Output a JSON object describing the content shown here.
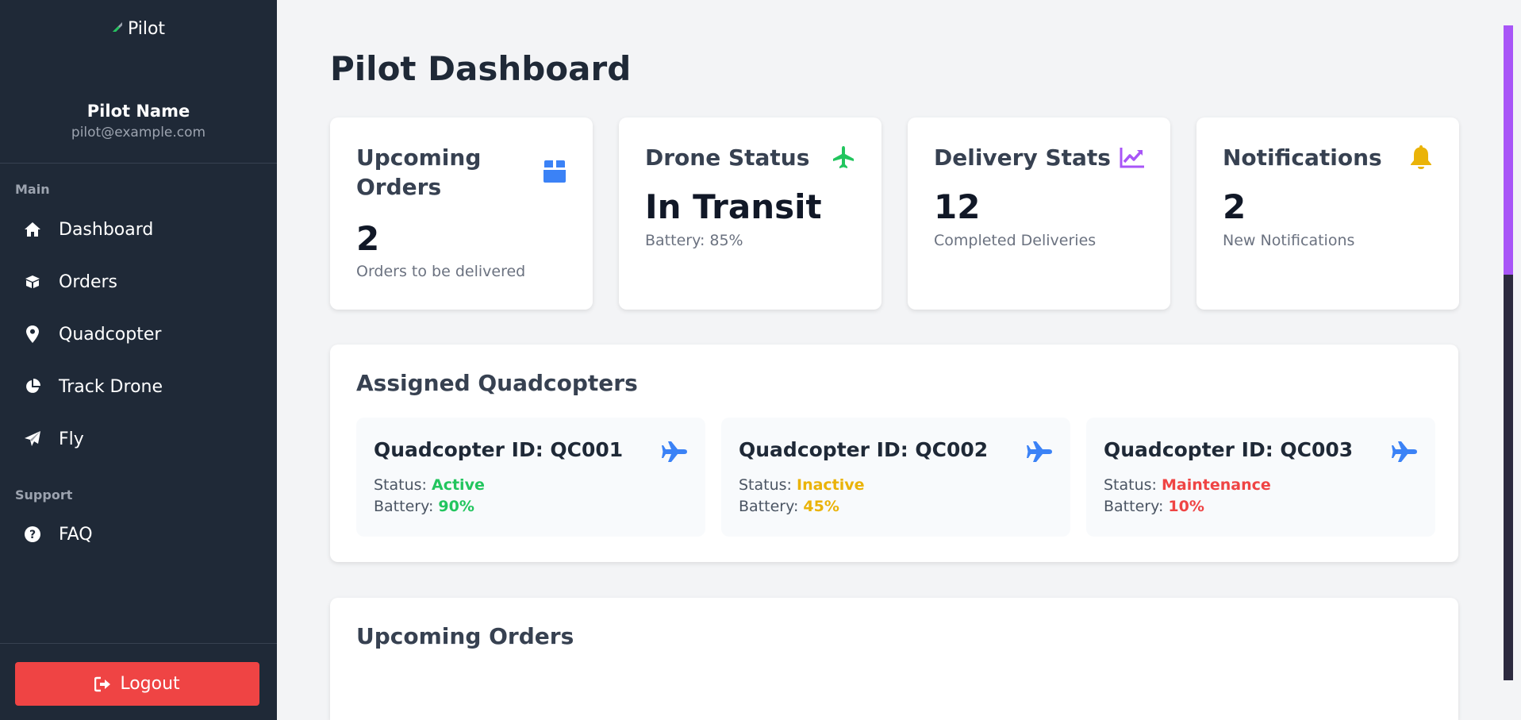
{
  "app": {
    "brand": "Pilot"
  },
  "profile": {
    "name": "Pilot Name",
    "email": "pilot@example.com"
  },
  "sidebar": {
    "section_main": "Main",
    "section_support": "Support",
    "items": [
      {
        "label": "Dashboard",
        "icon": "home-icon"
      },
      {
        "label": "Orders",
        "icon": "box-icon"
      },
      {
        "label": "Quadcopter",
        "icon": "map-pin-icon"
      },
      {
        "label": "Track Drone",
        "icon": "pie-chart-icon"
      },
      {
        "label": "Fly",
        "icon": "paper-plane-icon"
      }
    ],
    "support_items": [
      {
        "label": "FAQ",
        "icon": "question-icon"
      }
    ],
    "logout_label": "Logout"
  },
  "page": {
    "title": "Pilot Dashboard"
  },
  "stats": [
    {
      "title": "Upcoming Orders",
      "value": "2",
      "sub": "Orders to be delivered",
      "icon": "box-icon",
      "color": "#3b82f6"
    },
    {
      "title": "Drone Status",
      "value": "In Transit",
      "sub": "Battery: 85%",
      "icon": "plane-icon",
      "color": "#22c55e"
    },
    {
      "title": "Delivery Stats",
      "value": "12",
      "sub": "Completed Deliveries",
      "icon": "trend-chart-icon",
      "color": "#a855f7"
    },
    {
      "title": "Notifications",
      "value": "2",
      "sub": "New Notifications",
      "icon": "bell-icon",
      "color": "#eab308"
    }
  ],
  "assigned": {
    "title": "Assigned Quadcopters",
    "status_label": "Status:",
    "battery_label": "Battery:",
    "items": [
      {
        "title": "Quadcopter ID: QC001",
        "status": "Active",
        "battery": "90%",
        "color": "#22c55e"
      },
      {
        "title": "Quadcopter ID: QC002",
        "status": "Inactive",
        "battery": "45%",
        "color": "#eab308"
      },
      {
        "title": "Quadcopter ID: QC003",
        "status": "Maintenance",
        "battery": "10%",
        "color": "#ef4444"
      }
    ]
  },
  "upcoming": {
    "title": "Upcoming Orders"
  },
  "colors": {
    "accent_blue": "#3b82f6",
    "sidebar_bg": "#1f2937",
    "logout_red": "#ef4444",
    "scrollbar_thumb": "#a855f7"
  }
}
